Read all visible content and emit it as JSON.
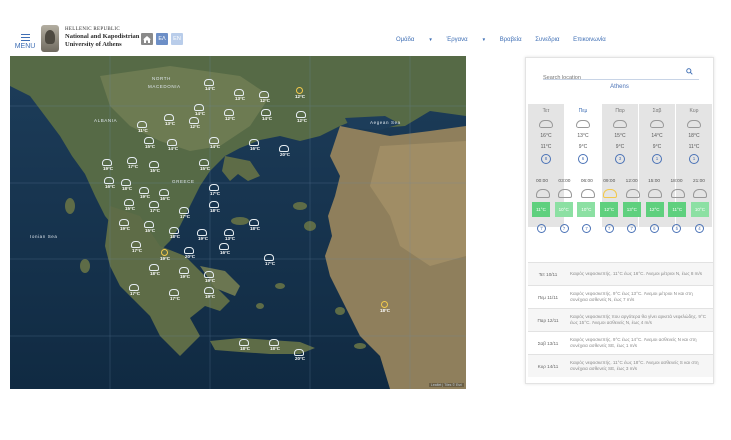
{
  "header": {
    "menu_label": "MENU",
    "logo": {
      "line1": "HELLENIC REPUBLIC",
      "line2": "National and Kapodistrian",
      "line3": "University of Athens"
    },
    "lang_el": "ΕΛ",
    "lang_en": "EN",
    "nav": [
      {
        "label": "Ομάδα",
        "dropdown": true
      },
      {
        "label": "Έργανα",
        "dropdown": true
      },
      {
        "label": "Βραβεία",
        "dropdown": false
      },
      {
        "label": "Συνεδρια",
        "dropdown": false
      },
      {
        "label": "Επικοινωνία",
        "dropdown": false
      }
    ]
  },
  "map": {
    "labels": [
      {
        "text": "NORTH",
        "id": "north-macedonia-1"
      },
      {
        "text": "MACEDONIA",
        "id": "north-macedonia-2"
      },
      {
        "text": "ALBANIA",
        "id": "albania"
      },
      {
        "text": "GREECE",
        "id": "greece"
      },
      {
        "text": "Aegean Sea",
        "id": "aegean"
      },
      {
        "text": "Ionian Sea",
        "id": "ionian"
      }
    ],
    "temps": [
      "14°C",
      "13°C",
      "12°C",
      "12°C",
      "14°C",
      "12°C",
      "14°C",
      "12°C",
      "13°C",
      "12°C",
      "11°C",
      "15°C",
      "14°C",
      "14°C",
      "16°C",
      "20°C",
      "19°C",
      "17°C",
      "15°C",
      "15°C",
      "16°C",
      "18°C",
      "19°C",
      "16°C",
      "17°C",
      "15°C",
      "17°C",
      "17°C",
      "18°C",
      "18°C",
      "19°C",
      "15°C",
      "18°C",
      "19°C",
      "13°C",
      "17°C",
      "19°C",
      "20°C",
      "16°C",
      "17°C",
      "18°C",
      "19°C",
      "19°C",
      "17°C",
      "17°C",
      "19°C",
      "18°C",
      "18°C",
      "20°C",
      "18°C"
    ],
    "attribution": "Leaflet | Tiles © Esri"
  },
  "panel": {
    "search_placeholder": "Search location",
    "city": "Athens",
    "days": [
      {
        "name": "Τετ",
        "hi": "16°C",
        "lo": "11°C",
        "wind": "8",
        "active": false
      },
      {
        "name": "Πεμ",
        "hi": "13°C",
        "lo": "9°C",
        "wind": "6",
        "active": true
      },
      {
        "name": "Παρ",
        "hi": "15°C",
        "lo": "9°C",
        "wind": "3",
        "active": false
      },
      {
        "name": "Σαβ",
        "hi": "14°C",
        "lo": "9°C",
        "wind": "1",
        "active": false
      },
      {
        "name": "Κυρ",
        "hi": "18°C",
        "lo": "11°C",
        "wind": "1",
        "active": false
      }
    ],
    "hours": [
      "00:00",
      "03:00",
      "06:00",
      "09:00",
      "12:00",
      "15:00",
      "18:00",
      "21:00"
    ],
    "hour_temps": [
      "11°C",
      "10°C",
      "10°C",
      "12°C",
      "13°C",
      "12°C",
      "11°C",
      "10°C"
    ],
    "hour_winds": [
      "7",
      "7",
      "7",
      "7",
      "7",
      "6",
      "5",
      "4"
    ],
    "forecast": [
      {
        "day": "Τετ 10/11",
        "text": "Καιρός νεφοσκεπής. 11°C έως 16°C. Άνεμοι μέτριοι N, έως 8 m/s"
      },
      {
        "day": "Πεμ 11/11",
        "text": "Καιρός νεφοσκεπής. 9°C έως 13°C. Άνεμοι μέτριοι N και στη συνέχεια ασθενείς N, έως 7 m/s"
      },
      {
        "day": "Παρ 12/11",
        "text": "Καιρός νεφοσκεπής που αργότερα θα γίνει αρκετά νεφελώδης. 9°C έως 15°C. Άνεμοι ασθενείς N, έως 4 m/s"
      },
      {
        "day": "Σαβ 13/11",
        "text": "Καιρός νεφοσκεπής. 9°C έως 14°C. Άνεμοι ασθενείς N και στη συνέχεια ασθενείς SE, έως 1 m/s"
      },
      {
        "day": "Κυρ 14/11",
        "text": "Καιρός νεφοσκεπής. 11°C έως 18°C. Άνεμοι ασθενείς S και στη συνέχεια ασθενείς SE, έως 3 m/s"
      }
    ]
  }
}
